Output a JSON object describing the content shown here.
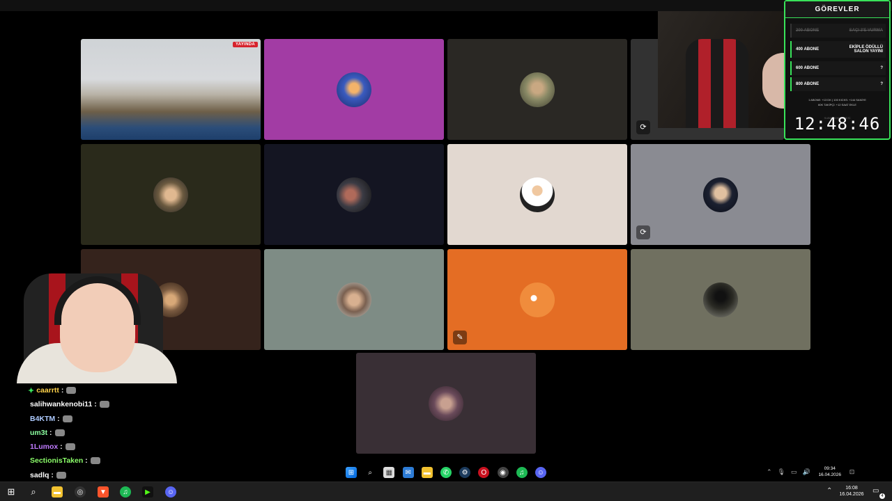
{
  "stream_overlay": {
    "panel_title": "GÖREVLER",
    "tasks": [
      {
        "amount": "200 ABONE",
        "reward": "SAÇI 3'E VURMA",
        "done": true
      },
      {
        "amount": "400 ABONE",
        "reward": "EKİPLE ÖDÜLLÜ SALON YAYINI",
        "done": false
      },
      {
        "amount": "600 ABONE",
        "reward": "?",
        "done": false
      },
      {
        "amount": "800 ABONE",
        "reward": "?",
        "done": false
      }
    ],
    "rates_line1": "1 ABONE: +13 DK  |  100 KICKS: +144 SANİYE",
    "rates_line2": "60K TAKİPÇİ: +12 SAAT EKLE",
    "timer_label": "SUBATHON SÜRESİ",
    "timer": "12:48:46",
    "game_badge": "YAYINDA"
  },
  "call_grid": {
    "tiles": [
      {
        "id": "game",
        "bg": "#2a4c78"
      },
      {
        "id": "p2",
        "bg": "#a23ca4",
        "avatar": "#3a5bbf"
      },
      {
        "id": "p3",
        "bg": "#2a2824",
        "avatar": "#8a8a66"
      },
      {
        "id": "p4",
        "bg": "#323232",
        "muted": true
      },
      {
        "id": "p5",
        "bg": "#2a2a1b",
        "avatar": "#6b5a40"
      },
      {
        "id": "p6",
        "bg": "#141522",
        "avatar": "#3b3b44"
      },
      {
        "id": "p7",
        "bg": "#e2d8d0",
        "avatar": "#ffffff"
      },
      {
        "id": "p8",
        "bg": "#8a8b92",
        "avatar": "#1b2030",
        "muted": true
      },
      {
        "id": "p9",
        "bg": "#35231c",
        "avatar": "#7a5a40"
      },
      {
        "id": "p10",
        "bg": "#7e8c85",
        "avatar": "#7a6050"
      },
      {
        "id": "p11",
        "bg": "#e46d24",
        "avatar": "#f08c3c",
        "muted": true
      },
      {
        "id": "p12",
        "bg": "#707060",
        "avatar": "#2a2a24"
      },
      {
        "id": "p13",
        "bg": "#392f35",
        "avatar": "#6a4a5a"
      }
    ]
  },
  "chat": [
    {
      "user": "caarrtt",
      "color": "#ffd24a",
      "star": true
    },
    {
      "user": "salihwankenobi11",
      "color": "#ffffff"
    },
    {
      "user": "B4KTM",
      "color": "#aecbff"
    },
    {
      "user": "um3t",
      "color": "#8cffa0"
    },
    {
      "user": "1Lumox",
      "color": "#c07bff"
    },
    {
      "user": "SectionisTaken",
      "color": "#8cff6a"
    },
    {
      "user": "sadlq",
      "color": "#ffffff"
    }
  ],
  "tray": {
    "time": "09:34",
    "date": "16.04.2026"
  },
  "taskbar": {
    "time": "16:08",
    "date": "16.04.2026",
    "notification_count": "4"
  }
}
